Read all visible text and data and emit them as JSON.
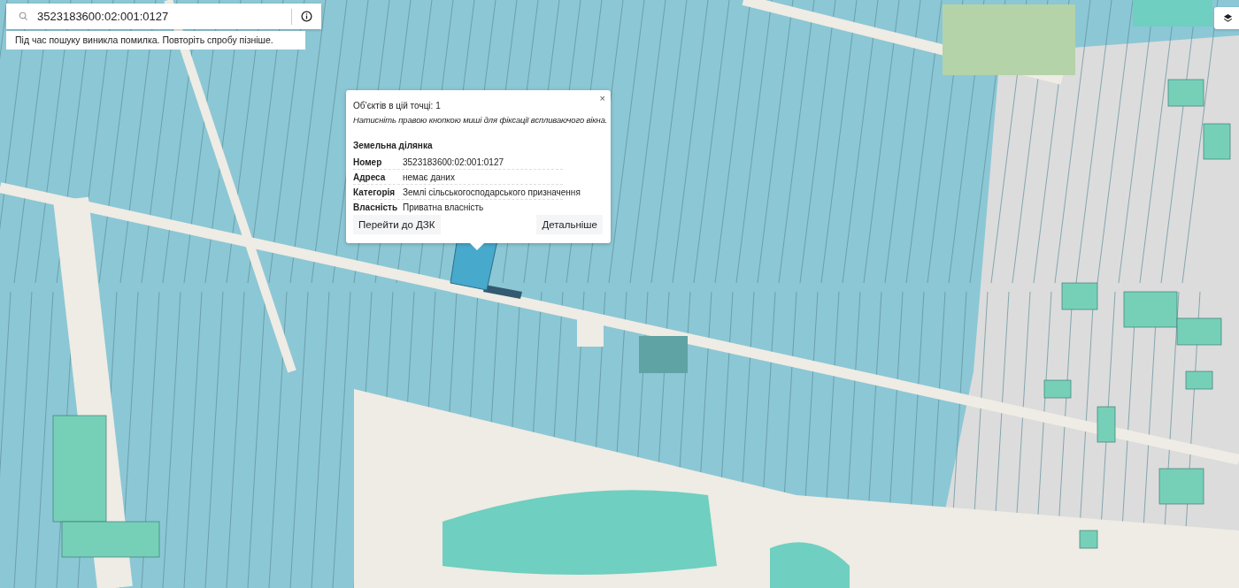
{
  "search": {
    "value": "3523183600:02:001:0127",
    "error": "Під час пошуку виникла помилка. Повторіть спробу пізніше."
  },
  "popup": {
    "count_label": "Об’єктів в цій точці: 1",
    "hint": "Натисніть правою кнопкою миші для фіксації вспливаючого вікна.",
    "close": "×",
    "section_title": "Земельна ділянка",
    "rows": [
      {
        "label": "Номер",
        "value": "3523183600:02:001:0127"
      },
      {
        "label": "Адреса",
        "value": "немає даних"
      },
      {
        "label": "Категорія",
        "value": "Землі сільськогосподарського призначення"
      },
      {
        "label": "Власність",
        "value": "Приватна власність"
      }
    ],
    "buttons": [
      "Перейти до ДЗК",
      "Детальніше"
    ]
  }
}
